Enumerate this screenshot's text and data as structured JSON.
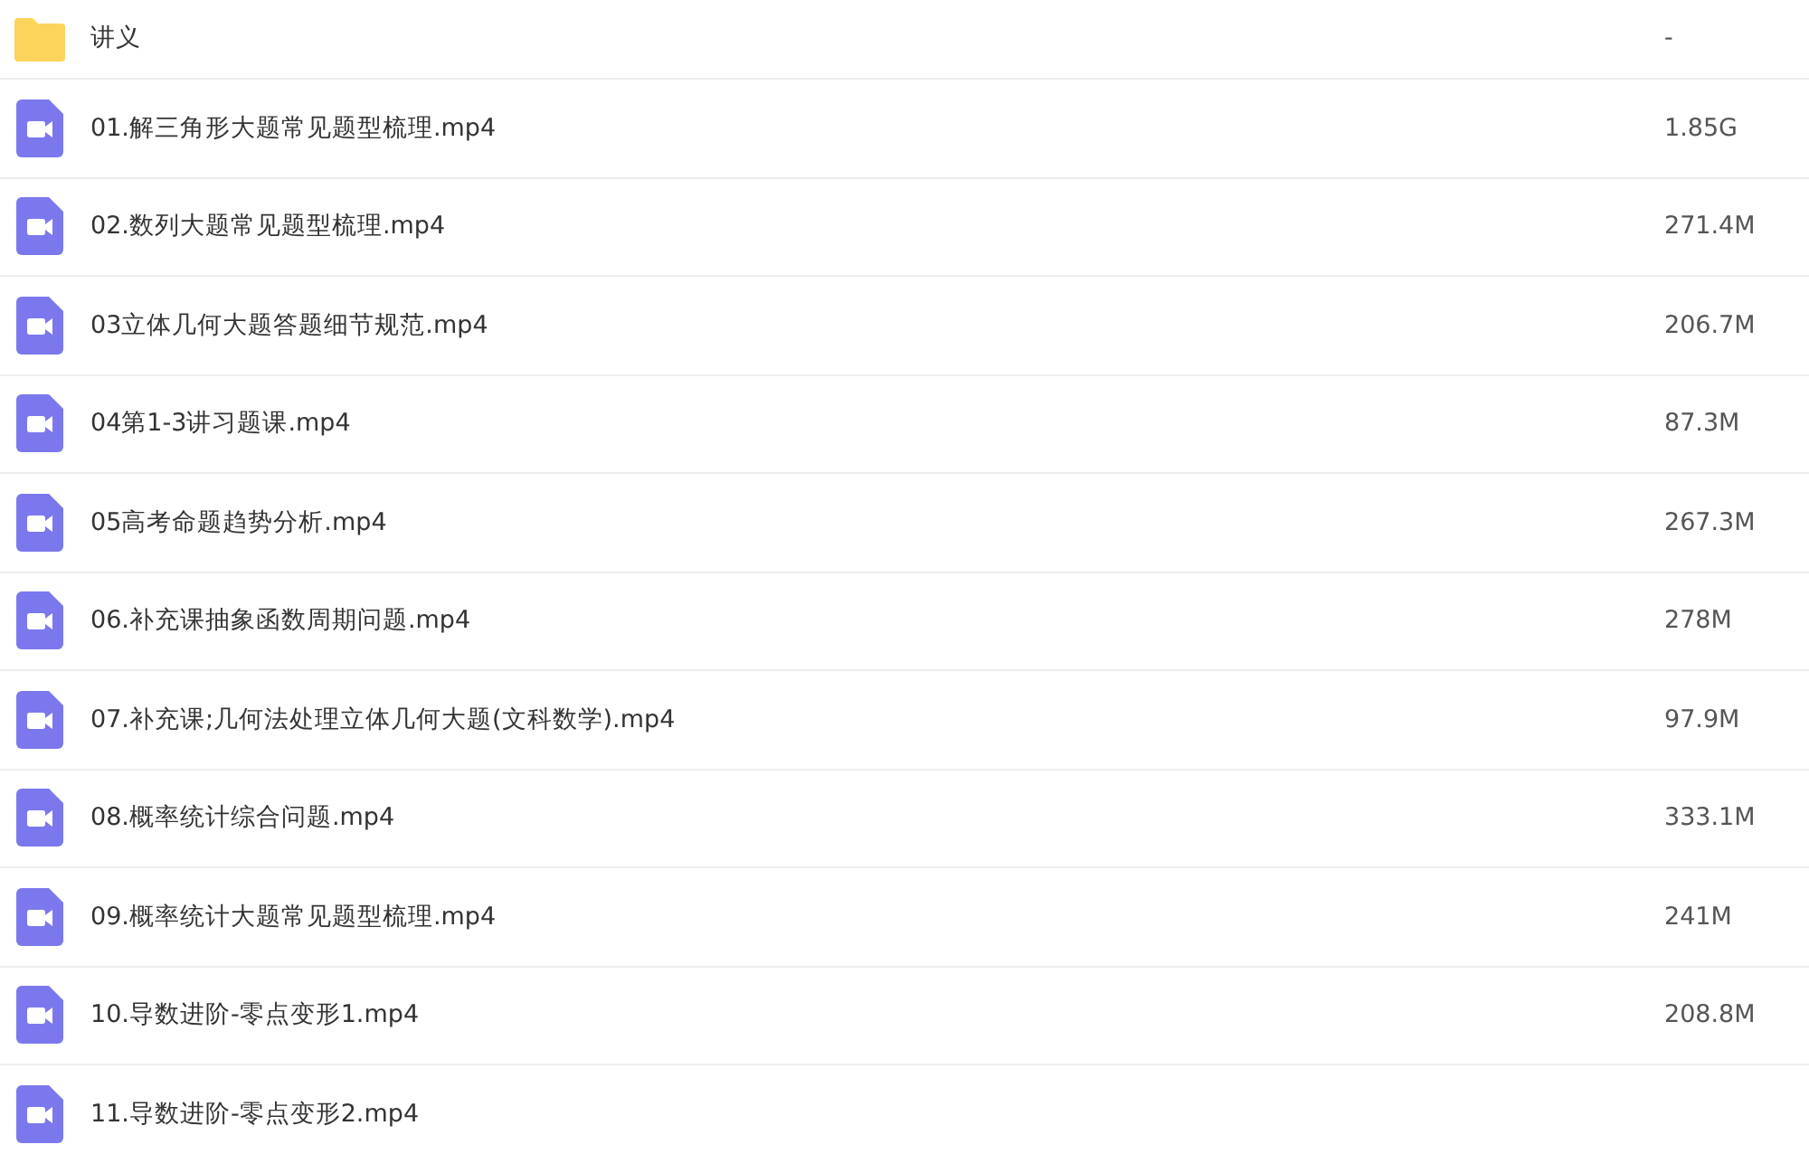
{
  "files": [
    {
      "kind": "folder",
      "name": "讲义",
      "size": "-"
    },
    {
      "kind": "video",
      "name": "01.解三角形大题常见题型梳理.mp4",
      "size": "1.85G"
    },
    {
      "kind": "video",
      "name": "02.数列大题常见题型梳理.mp4",
      "size": "271.4M"
    },
    {
      "kind": "video",
      "name": "03立体几何大题答题细节规范.mp4",
      "size": "206.7M"
    },
    {
      "kind": "video",
      "name": "04第1-3讲习题课.mp4",
      "size": "87.3M"
    },
    {
      "kind": "video",
      "name": "05高考命题趋势分析.mp4",
      "size": "267.3M"
    },
    {
      "kind": "video",
      "name": "06.补充课抽象函数周期问题.mp4",
      "size": "278M"
    },
    {
      "kind": "video",
      "name": "07.补充课;几何法处理立体几何大题(文科数学).mp4",
      "size": "97.9M"
    },
    {
      "kind": "video",
      "name": "08.概率统计综合问题.mp4",
      "size": "333.1M"
    },
    {
      "kind": "video",
      "name": "09.概率统计大题常见题型梳理.mp4",
      "size": "241M"
    },
    {
      "kind": "video",
      "name": "10.导数进阶-零点变形1.mp4",
      "size": "208.8M"
    },
    {
      "kind": "video",
      "name": "11.导数进阶-零点变形2.mp4"
    }
  ]
}
